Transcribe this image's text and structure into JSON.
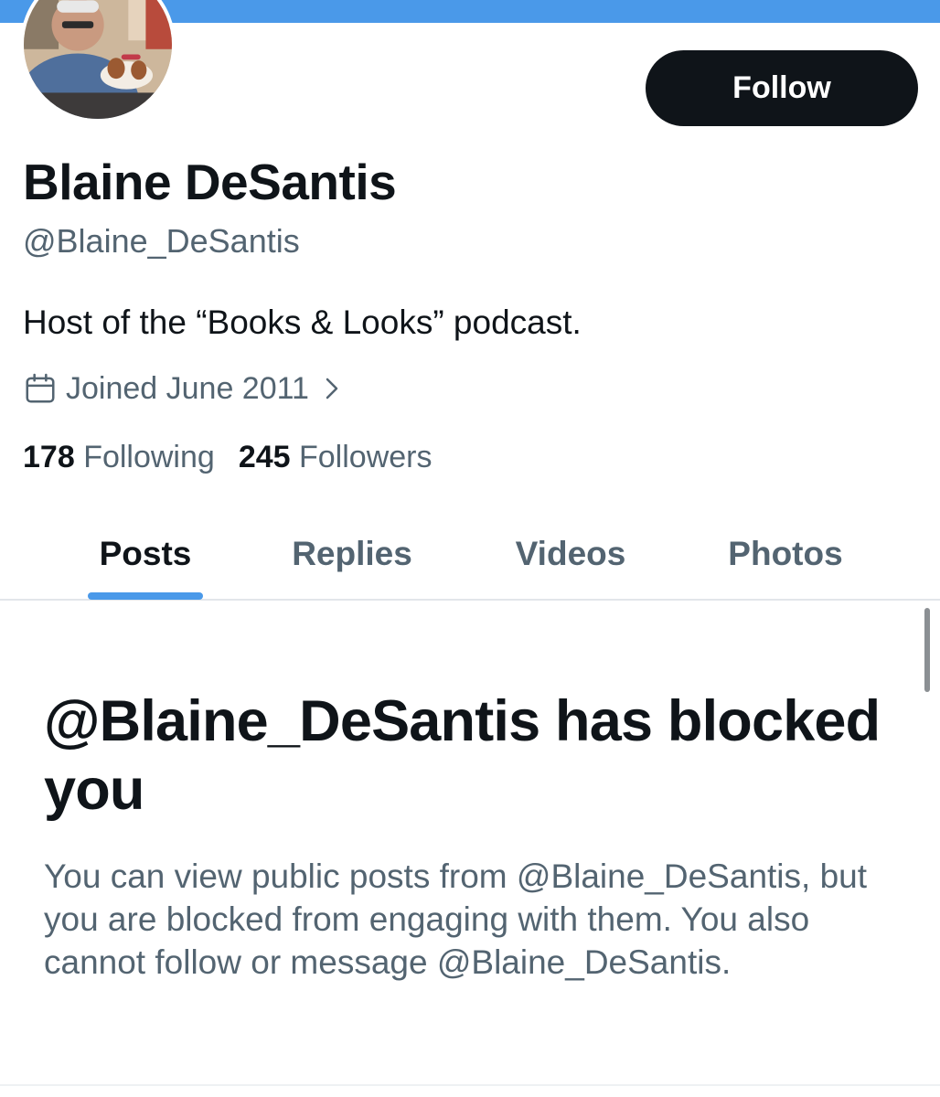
{
  "theme": {
    "accent": "#4a99e9",
    "text_primary": "#0f1419",
    "text_secondary": "#536471",
    "button_bg": "#0f1419",
    "button_text": "#ffffff"
  },
  "profile": {
    "avatar_icon": "profile-photo",
    "display_name": "Blaine DeSantis",
    "handle": "@Blaine_DeSantis",
    "bio": "Host of the “Books & Looks” podcast.",
    "joined": {
      "icon": "calendar-icon",
      "text": "Joined June 2011",
      "chevron_icon": "chevron-right-icon"
    },
    "stats": {
      "following_count": "178",
      "following_label": "Following",
      "followers_count": "245",
      "followers_label": "Followers"
    }
  },
  "actions": {
    "follow_label": "Follow"
  },
  "tabs": [
    {
      "label": "Posts",
      "active": true
    },
    {
      "label": "Replies",
      "active": false
    },
    {
      "label": "Videos",
      "active": false
    },
    {
      "label": "Photos",
      "active": false
    }
  ],
  "blocked_notice": {
    "title": "@Blaine_DeSantis has blocked you",
    "body": "You can view public posts from @Blaine_DeSantis, but you are blocked from engaging with them. You also cannot follow or message @Blaine_DeSantis."
  }
}
